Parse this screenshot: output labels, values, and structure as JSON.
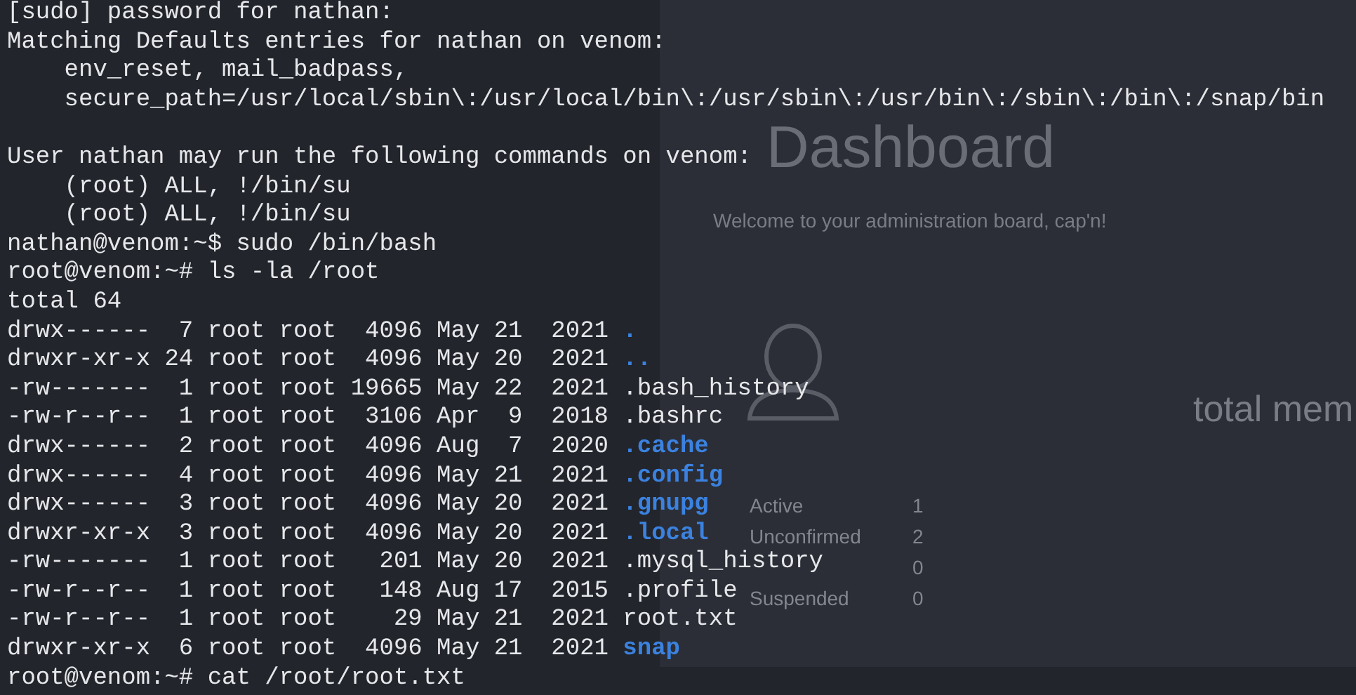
{
  "background_page": {
    "title": "Dashboard",
    "subtitle": "Welcome to your administration board, cap'n!",
    "card_title": "total mem",
    "stats": [
      {
        "label": "Active",
        "value": "1"
      },
      {
        "label": "Unconfirmed",
        "value": "2"
      },
      {
        "value": "0"
      },
      {
        "label": "Suspended",
        "value": "0"
      }
    ]
  },
  "terminal": {
    "lines": [
      {
        "kind": "text",
        "text": "[sudo] password for nathan:"
      },
      {
        "kind": "text",
        "text": "Matching Defaults entries for nathan on venom:"
      },
      {
        "kind": "text",
        "text": "    env_reset, mail_badpass,"
      },
      {
        "kind": "text",
        "text": "    secure_path=/usr/local/sbin\\:/usr/local/bin\\:/usr/sbin\\:/usr/bin\\:/sbin\\:/bin\\:/snap/bin"
      },
      {
        "kind": "blank"
      },
      {
        "kind": "text",
        "text": "User nathan may run the following commands on venom:"
      },
      {
        "kind": "text",
        "text": "    (root) ALL, !/bin/su"
      },
      {
        "kind": "text",
        "text": "    (root) ALL, !/bin/su"
      },
      {
        "kind": "prompt",
        "text": "nathan@venom:~$ sudo /bin/bash"
      },
      {
        "kind": "prompt",
        "text": "root@venom:~# ls -la /root"
      },
      {
        "kind": "text",
        "text": "total 64"
      },
      {
        "kind": "entry",
        "text": "drwx------  7 root root  4096 May 21  2021 ",
        "name": ".",
        "directory": true
      },
      {
        "kind": "entry",
        "text": "drwxr-xr-x 24 root root  4096 May 20  2021 ",
        "name": "..",
        "directory": true
      },
      {
        "kind": "entry",
        "text": "-rw-------  1 root root 19665 May 22  2021 ",
        "name": ".bash_history",
        "directory": false
      },
      {
        "kind": "entry",
        "text": "-rw-r--r--  1 root root  3106 Apr  9  2018 ",
        "name": ".bashrc",
        "directory": false
      },
      {
        "kind": "entry",
        "text": "drwx------  2 root root  4096 Aug  7  2020 ",
        "name": ".cache",
        "directory": true
      },
      {
        "kind": "entry",
        "text": "drwx------  4 root root  4096 May 21  2021 ",
        "name": ".config",
        "directory": true
      },
      {
        "kind": "entry",
        "text": "drwx------  3 root root  4096 May 20  2021 ",
        "name": ".gnupg",
        "directory": true
      },
      {
        "kind": "entry",
        "text": "drwxr-xr-x  3 root root  4096 May 20  2021 ",
        "name": ".local",
        "directory": true
      },
      {
        "kind": "entry",
        "text": "-rw-------  1 root root   201 May 20  2021 ",
        "name": ".mysql_history",
        "directory": false
      },
      {
        "kind": "entry",
        "text": "-rw-r--r--  1 root root   148 Aug 17  2015 ",
        "name": ".profile",
        "directory": false
      },
      {
        "kind": "entry",
        "text": "-rw-r--r--  1 root root    29 May 21  2021 ",
        "name": "root.txt",
        "directory": false
      },
      {
        "kind": "entry",
        "text": "drwxr-xr-x  6 root root  4096 May 21  2021 ",
        "name": "snap",
        "directory": true
      },
      {
        "kind": "prompt",
        "text": "root@venom:~# cat /root/root.txt"
      }
    ]
  }
}
